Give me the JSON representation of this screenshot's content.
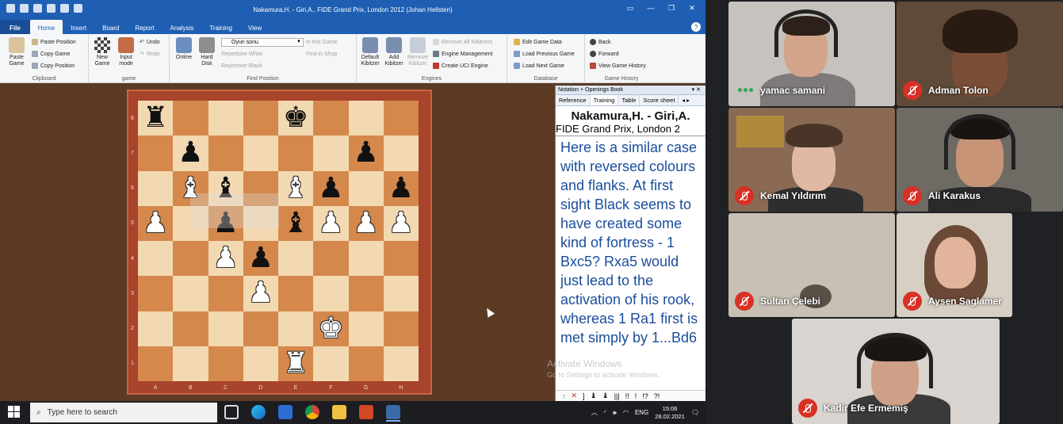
{
  "window": {
    "title": "Nakamura,H. - Giri,A., FIDE Grand Prix, London 2012 (Johan Hellsten)"
  },
  "menu": {
    "file": "File",
    "tabs": [
      "Home",
      "Insert",
      "Board",
      "Report",
      "Analysis",
      "Training",
      "View"
    ],
    "active": "Home"
  },
  "ribbon": {
    "clipboard": {
      "label": "Clipboard",
      "paste_game": "Paste Game",
      "paste_position": "Paste Position",
      "copy_game": "Copy Game",
      "copy_position": "Copy Position"
    },
    "game": {
      "label": "game",
      "new_game": "New Game",
      "input_mode": "Input mode",
      "undo": "Undo",
      "redo": "Redo"
    },
    "find_position": {
      "label": "Find Position",
      "online": "Online",
      "hard_disk": "Hard Disk",
      "opening_combo": "Oyun sonu",
      "in_this_game": "In this Game",
      "repertoire_white": "Repertoire White",
      "repertoire_black": "Repertoire Black",
      "find_in_shop": "Find in Shop"
    },
    "engines": {
      "label": "Engines",
      "default_kibitzer": "Default Kibitzer",
      "add_kibitzer": "Add Kibitzer",
      "remove_kibitzer": "Remove Kibitzer",
      "remove_all_kibitzers": "Remove All Kibitzers",
      "engine_management": "Engine Management",
      "create_uci_engine": "Create UCI Engine"
    },
    "database": {
      "label": "Database",
      "edit_game_data": "Edit Game Data",
      "load_previous_game": "Load Previous Game",
      "load_next_game": "Load Next Game"
    },
    "game_history": {
      "label": "Game History",
      "back": "Back",
      "forward": "Forward",
      "view_game_history": "View Game History"
    }
  },
  "board": {
    "ranks": [
      "8",
      "7",
      "6",
      "5",
      "4",
      "3",
      "2",
      "1"
    ],
    "files": [
      "A",
      "B",
      "C",
      "D",
      "E",
      "F",
      "G",
      "H"
    ],
    "position": [
      [
        "bR",
        "",
        "",
        "",
        "bK",
        "",
        "",
        ""
      ],
      [
        "",
        "bP",
        "",
        "",
        "",
        "",
        "bP",
        ""
      ],
      [
        "",
        "wB",
        "bB",
        "",
        "wB",
        "bP",
        "",
        "bP"
      ],
      [
        "wP",
        "",
        "bP",
        "",
        "bB",
        "wP",
        "wP",
        "wP"
      ],
      [
        "",
        "",
        "wP",
        "bP",
        "",
        "",
        "",
        ""
      ],
      [
        "",
        "",
        "",
        "wP",
        "",
        "",
        "",
        ""
      ],
      [
        "",
        "",
        "",
        "",
        "",
        "wK",
        "",
        ""
      ],
      [
        "",
        "",
        "",
        "",
        "wR",
        "",
        "",
        ""
      ]
    ],
    "colors": {
      "light": "#f3d9b1",
      "dark": "#d4884b",
      "frame": "#a8432c"
    }
  },
  "notation": {
    "pane_title": "Notation + Openings Book",
    "tabs": [
      "Reference",
      "Training",
      "Table",
      "Score sheet"
    ],
    "active_tab": "Training",
    "game_header": "Nakamura,H. - Giri,A.",
    "event": "FIDE Grand Prix, London 2",
    "text": "Here is a similar case with reversed colours and flanks. At first sight Black seems to have created some kind of fortress - 1 Bxc5? Rxa5 would just lead to the activation of his rook, whereas 1 Ra1 first is met simply by 1...Bd6",
    "toolbar": [
      "↑",
      "✕",
      "]",
      "♝",
      "♝",
      "|||",
      "!!",
      "!",
      "!?",
      "?!"
    ]
  },
  "watermark": {
    "line1": "Activate Windows",
    "line2": "Go to Settings to activate Windows."
  },
  "taskbar": {
    "search_placeholder": "Type here to search",
    "lang": "ENG",
    "time": "15:06",
    "date": "28.02.2021"
  },
  "meeting": {
    "participants": [
      {
        "name": "yamac samani",
        "muted": false
      },
      {
        "name": "Adman Tolon",
        "muted": true
      },
      {
        "name": "Kemal Yıldırım",
        "muted": true
      },
      {
        "name": "Ali Karakus",
        "muted": true
      },
      {
        "name": "Sultan Çelebi",
        "muted": true
      },
      {
        "name": "Aysen Saglamer",
        "muted": true
      },
      {
        "name": "Kadir Efe Ermemiş",
        "muted": true
      }
    ]
  }
}
